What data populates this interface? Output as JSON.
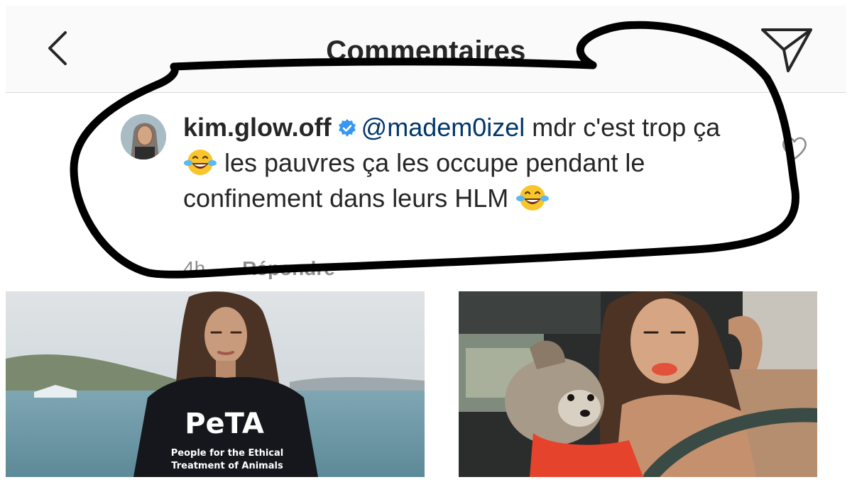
{
  "header": {
    "title": "Commentaires",
    "back_icon": "chevron-left-icon",
    "share_icon": "paper-plane-icon"
  },
  "comment": {
    "username": "kim.glow.off",
    "mention": "@madem0izel",
    "text_part1": " mdr c'est trop ça ",
    "text_part2": " les pauvres ça les occupe pendant le confinement dans leurs HLM ",
    "emoji_icon": "laughing-tears-emoji",
    "time": "4h",
    "reply_label": "Répondre"
  },
  "photo_left": {
    "shirt_logo": "PeTA",
    "shirt_line1": "People for the Ethical",
    "shirt_line2": "Treatment of Animals"
  },
  "colors": {
    "mention": "#00376b",
    "verified": "#3897f0",
    "scribble": "#000000"
  }
}
